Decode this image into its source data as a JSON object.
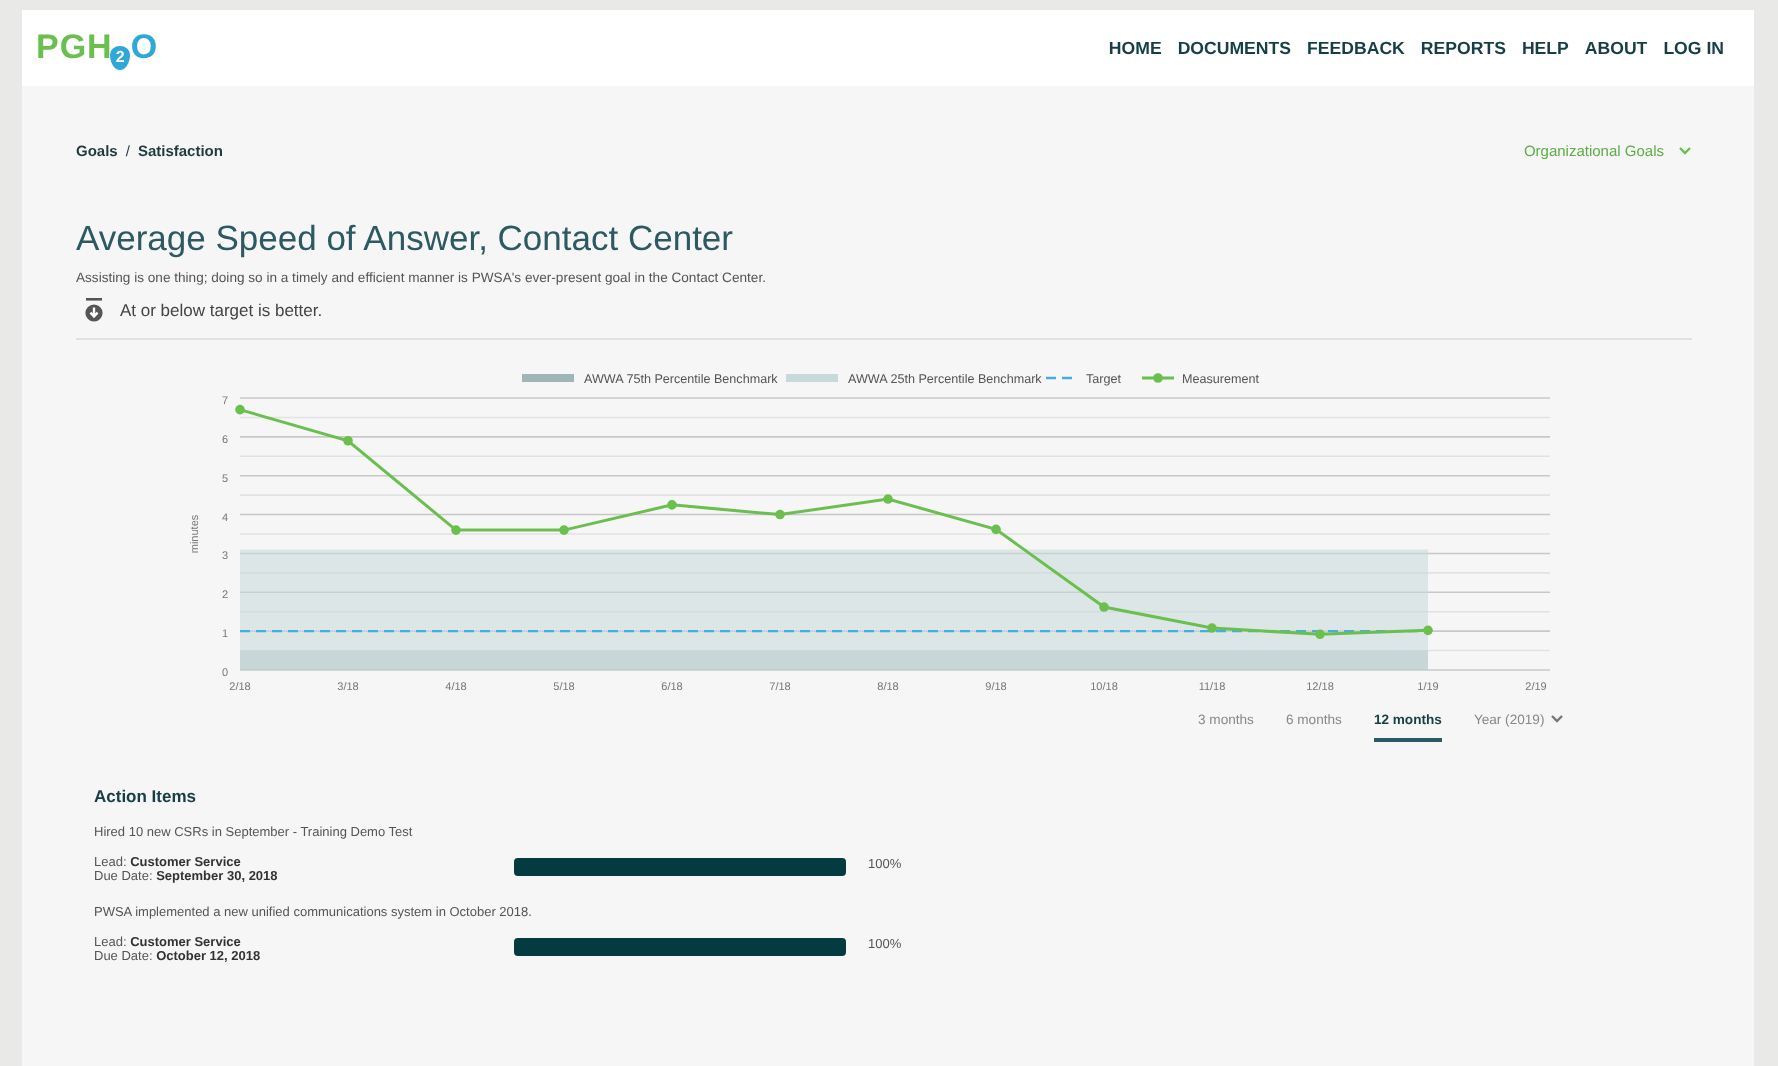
{
  "header": {
    "logo": {
      "left": "PGH",
      "drop": "2",
      "right": "O"
    },
    "nav": [
      {
        "label": "HOME"
      },
      {
        "label": "DOCUMENTS"
      },
      {
        "label": "FEEDBACK"
      },
      {
        "label": "REPORTS"
      },
      {
        "label": "HELP"
      },
      {
        "label": "ABOUT"
      },
      {
        "label": "LOG IN"
      }
    ]
  },
  "breadcrumbs": [
    "Goals",
    "Satisfaction"
  ],
  "breadcrumb_separator": "/",
  "goals_dropdown": {
    "label": "Organizational Goals"
  },
  "title": "Average Speed of Answer, Contact Center",
  "description": "Assisting is one thing; doing so in a timely and efficient manner is PWSA's ever-present goal in the Contact Center.",
  "target_note": "At or below target is better.",
  "chart": {
    "chart_data": {
      "type": "line",
      "ylabel": "minutes",
      "categories": [
        "2/18",
        "3/18",
        "4/18",
        "5/18",
        "6/18",
        "7/18",
        "8/18",
        "9/18",
        "10/18",
        "11/18",
        "12/18",
        "1/19",
        "2/19"
      ],
      "yticks": [
        0,
        1,
        2,
        3,
        4,
        5,
        6,
        7
      ],
      "ylim": [
        0,
        7
      ],
      "series": [
        {
          "name": "AWWA 75th Percentile Benchmark",
          "type": "area",
          "color": "#9fb5b7",
          "values": [
            0.5,
            0.5,
            0.5,
            0.5,
            0.5,
            0.5,
            0.5,
            0.5,
            0.5,
            0.5,
            0.5,
            0.5,
            null
          ]
        },
        {
          "name": "AWWA 25th Percentile Benchmark",
          "type": "area",
          "color": "#c9d8d8",
          "values": [
            3.1,
            3.1,
            3.1,
            3.1,
            3.1,
            3.1,
            3.1,
            3.1,
            3.1,
            3.1,
            3.1,
            3.1,
            null
          ]
        },
        {
          "name": "Target",
          "type": "line",
          "line_style": "dashed",
          "color": "#45aee0",
          "values": [
            1,
            1,
            1,
            1,
            1,
            1,
            1,
            1,
            1,
            1,
            1,
            1,
            null
          ]
        },
        {
          "name": "Measurement",
          "type": "line",
          "marker": "o",
          "color": "#6bbf4e",
          "values": [
            6.7,
            5.9,
            3.6,
            3.6,
            4.25,
            4.0,
            4.4,
            3.62,
            1.62,
            1.08,
            0.92,
            1.02,
            null
          ]
        }
      ],
      "grid": true,
      "legend": "top"
    }
  },
  "range_tabs": [
    {
      "label": "3 months",
      "selected": false
    },
    {
      "label": "6 months",
      "selected": false
    },
    {
      "label": "12 months",
      "selected": true
    },
    {
      "label": "Year (2019)",
      "selected": false,
      "kind": "dropdown"
    }
  ],
  "action_items": {
    "title": "Action Items",
    "items": [
      {
        "text": "Hired 10 new CSRs in September - Training Demo Test",
        "lead_label": "Lead:",
        "lead": "Customer Service",
        "due_label": "Due Date:",
        "due": "September 30, 2018",
        "level": 1.0,
        "percent": "100%"
      },
      {
        "text": "PWSA implemented a new unified communications system in October 2018.",
        "lead_label": "Lead:",
        "lead": "Customer Service",
        "due_label": "Due Date:",
        "due": "October 12, 2018",
        "level": 1.0,
        "percent": "100%"
      }
    ]
  }
}
